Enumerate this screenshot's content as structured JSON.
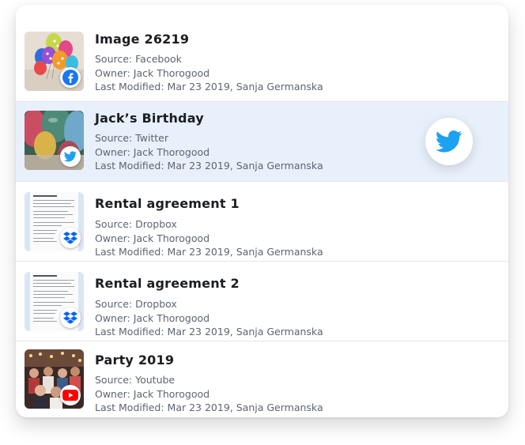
{
  "files": [
    {
      "title": "Image 26219",
      "source": "Source: Facebook",
      "owner": "Owner: Jack Thorogood",
      "modified": "Last Modified: Mar 23 2019, Sanja Germanska",
      "source_icon": "facebook-icon",
      "thumbnail": "balloons"
    },
    {
      "title": "Jack’s Birthday",
      "source": "Source: Twitter",
      "owner": "Owner: Jack Thorogood",
      "modified": "Last Modified: Mar 23 2019, Sanja Germanska",
      "source_icon": "twitter-icon",
      "thumbnail": "balloons-closeup",
      "selected": true
    },
    {
      "title": "Rental agreement 1",
      "source": "Source: Dropbox",
      "owner": "Owner: Jack Thorogood",
      "modified": "Last Modified: Mar 23 2019, Sanja Germanska",
      "source_icon": "dropbox-icon",
      "thumbnail": "document"
    },
    {
      "title": "Rental agreement 2",
      "source": "Source: Dropbox",
      "owner": "Owner: Jack Thorogood",
      "modified": "Last Modified: Mar 23 2019, Sanja Germanska",
      "source_icon": "dropbox-icon",
      "thumbnail": "document"
    },
    {
      "title": "Party 2019",
      "source": "Source: Youtube",
      "owner": "Owner: Jack Thorogood",
      "modified": "Last Modified: Mar 23 2019, Sanja Germanska",
      "source_icon": "youtube-icon",
      "thumbnail": "party-crowd"
    }
  ],
  "selected_action": {
    "icon": "twitter-icon"
  },
  "colors": {
    "selected_row": "#e8f0fb",
    "facebook": "#1877f2",
    "twitter": "#1da1f2",
    "dropbox": "#0061fe",
    "youtube": "#ff0000"
  }
}
